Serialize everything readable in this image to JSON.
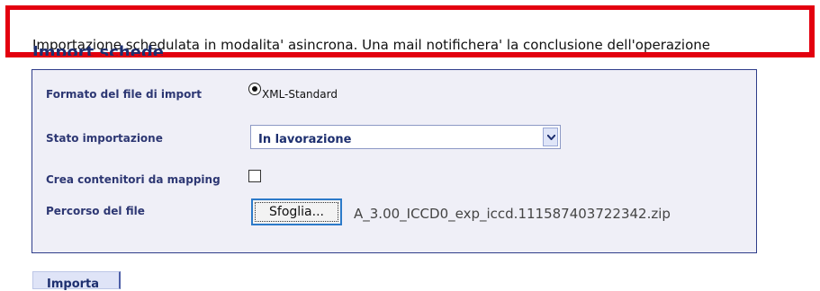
{
  "notice": {
    "message": "Importazione schedulata in modalita' asincrona. Una mail notifichera' la conclusione dell'operazione"
  },
  "page": {
    "title": "Import schede"
  },
  "form": {
    "format_label": "Formato del file di import",
    "format_option": "XML-Standard",
    "status_label": "Stato importazione",
    "status_value": "In lavorazione",
    "containers_label": "Crea contenitori da mapping",
    "file_path_label": "Percorso del file",
    "browse_label": "Sfoglia...",
    "selected_file": "A_3.00_ICCD0_exp_iccd.111587403722342.zip"
  },
  "actions": {
    "import_label": "Importa"
  }
}
